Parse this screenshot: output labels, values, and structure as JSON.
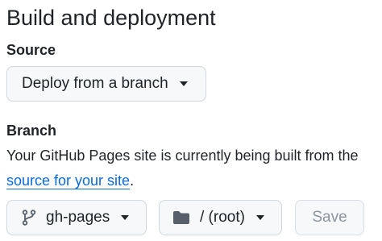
{
  "section": {
    "heading": "Build and deployment"
  },
  "source": {
    "label": "Source",
    "dropdown_value": "Deploy from a branch"
  },
  "branch": {
    "label": "Branch",
    "description_line1": "Your GitHub Pages site is currently being built from the",
    "link_text": "source for your site",
    "description_end": ".",
    "branch_value": "gh-pages",
    "folder_value": "/ (root)",
    "save_label": "Save"
  },
  "icons": {
    "branch": "git-branch-icon",
    "folder": "folder-icon",
    "caret": "triangle-down-icon"
  },
  "colors": {
    "link": "#0969da",
    "text": "#1f2328",
    "button_bg": "#f6f8fa",
    "button_border": "#d0d7de",
    "disabled_text": "#8c959f"
  }
}
